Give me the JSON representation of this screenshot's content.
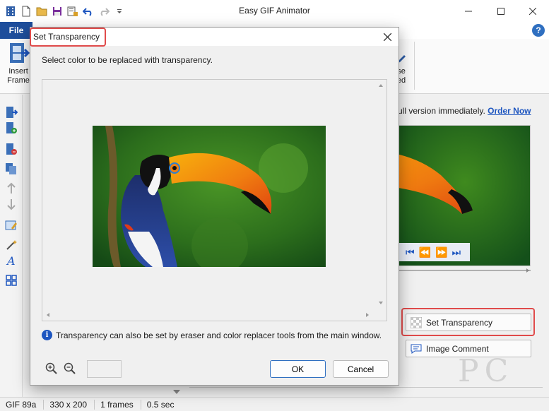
{
  "app": {
    "title": "Easy GIF Animator",
    "file_tab": "File",
    "help": "?"
  },
  "ribbon": {
    "insert_frame_line1": "Insert",
    "insert_frame_line2": "Frame",
    "right_item_line1": "se",
    "right_item_line2": "ed"
  },
  "banner": {
    "text": "ull version immediately.",
    "link": "Order Now"
  },
  "side_buttons": {
    "set_transparency": "Set Transparency",
    "image_comment": "Image Comment"
  },
  "status": {
    "format": "GIF 89a",
    "size": "330 x 200",
    "frames": "1 frames",
    "duration": "0.5 sec"
  },
  "dialog": {
    "title": "Set Transparency",
    "prompt": "Select color to be replaced with transparency.",
    "info": "Transparency can also be set by eraser and color replacer tools from the main window.",
    "zoom_value": "",
    "ok_label": "OK",
    "cancel_label": "Cancel"
  },
  "watermark": "PC",
  "colors": {
    "accent": "#1e4e9c",
    "link": "#1e56c0",
    "highlight": "#e04b4b"
  }
}
